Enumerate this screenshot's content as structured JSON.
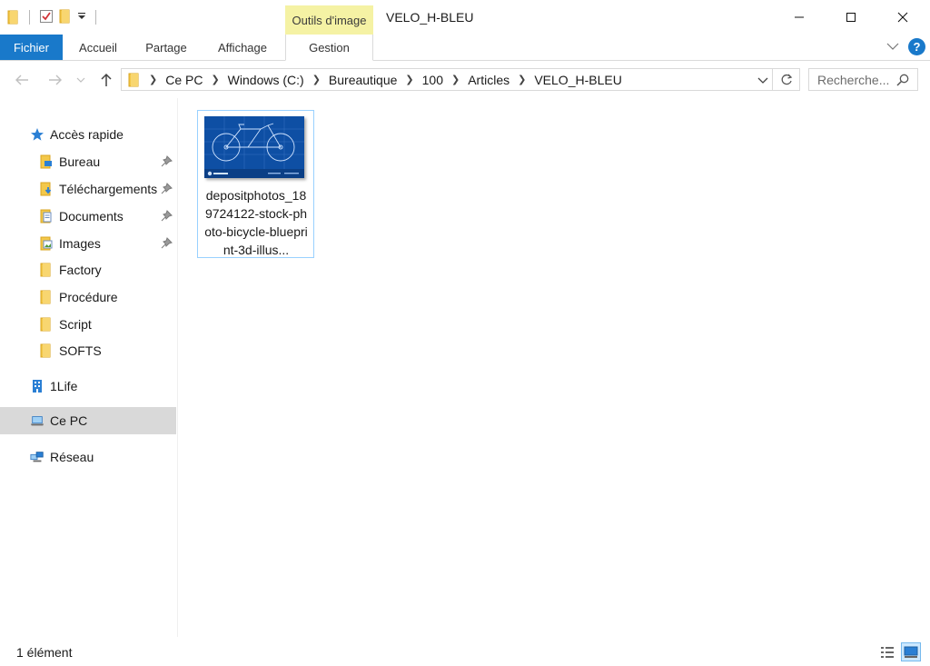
{
  "window": {
    "title": "VELO_H-BLEU",
    "context_tab_label": "Outils d'image"
  },
  "quick_access_toolbar": {
    "icons": [
      "folder-icon",
      "properties-checkmark-icon",
      "new-folder-icon",
      "customize-dropdown-icon"
    ]
  },
  "ribbon": {
    "tabs": [
      {
        "label": "Fichier",
        "active": true,
        "accent": "#1979ca"
      },
      {
        "label": "Accueil"
      },
      {
        "label": "Partage"
      },
      {
        "label": "Affichage"
      },
      {
        "label": "Gestion"
      }
    ],
    "help_label": "?"
  },
  "navigation": {
    "breadcrumb": [
      "Ce PC",
      "Windows (C:)",
      "Bureautique",
      "100",
      "Articles",
      "VELO_H-BLEU"
    ],
    "search_placeholder": "Recherche..."
  },
  "nav_pane": {
    "quick_access": {
      "label": "Accès rapide",
      "items": [
        {
          "label": "Bureau",
          "icon": "desktop-folder-icon",
          "pinned": true
        },
        {
          "label": "Téléchargements",
          "icon": "downloads-folder-icon",
          "pinned": true
        },
        {
          "label": "Documents",
          "icon": "documents-folder-icon",
          "pinned": true
        },
        {
          "label": "Images",
          "icon": "pictures-folder-icon",
          "pinned": true
        },
        {
          "label": "Factory",
          "icon": "folder-icon",
          "pinned": false
        },
        {
          "label": "Procédure",
          "icon": "folder-icon",
          "pinned": false
        },
        {
          "label": "Script",
          "icon": "folder-icon",
          "pinned": false
        },
        {
          "label": "SOFTS",
          "icon": "folder-icon",
          "pinned": false
        }
      ]
    },
    "onedrive": {
      "label": "1Life",
      "icon": "building-icon"
    },
    "this_pc": {
      "label": "Ce PC",
      "icon": "computer-icon",
      "selected": true
    },
    "network": {
      "label": "Réseau",
      "icon": "network-icon"
    }
  },
  "content": {
    "files": [
      {
        "name": "depositphotos_189724122-stock-photo-bicycle-blueprint-3d-illus...",
        "thumbnail": "bicycle-blueprint-thumbnail"
      }
    ]
  },
  "status_bar": {
    "item_count": "1 élément",
    "view_modes": [
      "details-view-icon",
      "large-icons-view-icon"
    ]
  },
  "colors": {
    "accent": "#1979ca",
    "context_tab": "#f5f2a4",
    "folder": "#f3c84a",
    "selection": "#d9d9d9",
    "thumb_blue": "#0e4fa4"
  }
}
